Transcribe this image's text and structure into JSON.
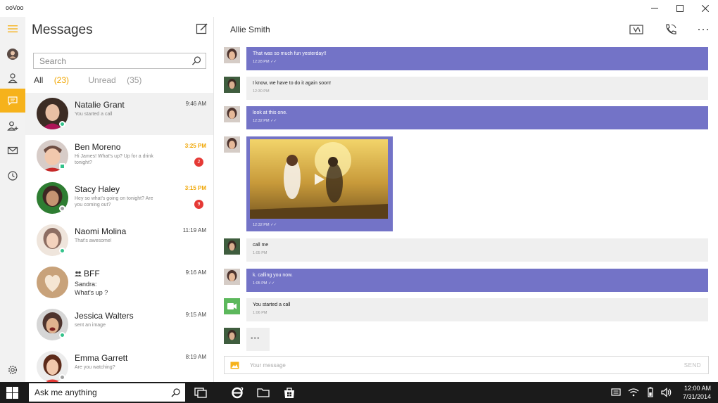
{
  "window": {
    "title": "ooVoo"
  },
  "sidebar": {
    "title": "Messages"
  },
  "search": {
    "placeholder": "Search"
  },
  "filters": {
    "all_label": "All",
    "all_count": "(23)",
    "unread_label": "Unread",
    "unread_count": "(35)"
  },
  "contacts": [
    {
      "name": "Natalie Grant",
      "preview": "You started a call",
      "time": "9:46 AM",
      "unread": false,
      "badge": "",
      "status_color": "#33c28a"
    },
    {
      "name": "Ben Moreno",
      "preview": "Hi James! What's up? Up for a drink tonight?",
      "time": "3:25 PM",
      "unread": true,
      "badge": "2",
      "status_color": "#33c28a"
    },
    {
      "name": "Stacy Haley",
      "preview": "Hey so what's going on tonight? Are you coming out?",
      "time": "3:15 PM",
      "unread": true,
      "badge": "9",
      "status_color": "#9e9e9e"
    },
    {
      "name": "Naomi Molina",
      "preview": "That's awesome!",
      "time": "11:19 AM",
      "unread": false,
      "badge": "",
      "status_color": "#33c28a"
    },
    {
      "name": "BFF",
      "preview": "Sandra:",
      "preview2": "What's up ?",
      "time": "9:16 AM",
      "unread": false,
      "badge": "",
      "status_color": ""
    },
    {
      "name": "Jessica Walters",
      "preview": "sent an image",
      "time": "9:15 AM",
      "unread": false,
      "badge": "",
      "status_color": "#33c28a"
    },
    {
      "name": "Emma Garrett",
      "preview": "Are you watching?",
      "time": "8:19 AM",
      "unread": false,
      "badge": "",
      "status_color": "#9e9e9e"
    }
  ],
  "chat": {
    "contact_name": "Allie Smith",
    "messages": [
      {
        "from": "me",
        "text": "That was so much fun yesterday!!",
        "time": "12:28 PM"
      },
      {
        "from": "them",
        "text": "I know, we have to do it again soon!",
        "time": "12:30 PM"
      },
      {
        "from": "me",
        "text": "look at this one.",
        "time": "12:32 PM"
      },
      {
        "from": "me",
        "text": "",
        "time": "12:32 PM"
      },
      {
        "from": "them",
        "text": "call me",
        "time": "1:05 PM"
      },
      {
        "from": "me",
        "text": "k. calling you now.",
        "time": "1:05 PM"
      },
      {
        "from": "them",
        "text": "You started a call",
        "time": "1:06 PM"
      },
      {
        "from": "them",
        "text": "•••",
        "time": ""
      }
    ],
    "composer_placeholder": "Your message",
    "send_label": "SEND"
  },
  "taskbar": {
    "search_placeholder": "Ask me anything",
    "time": "12:00 AM",
    "date": "7/31/2014"
  },
  "colors": {
    "accent": "#f6b21b",
    "outgoing": "#7373c7",
    "incoming": "#efefef",
    "unread": "#f0a500",
    "badge": "#e53935"
  }
}
